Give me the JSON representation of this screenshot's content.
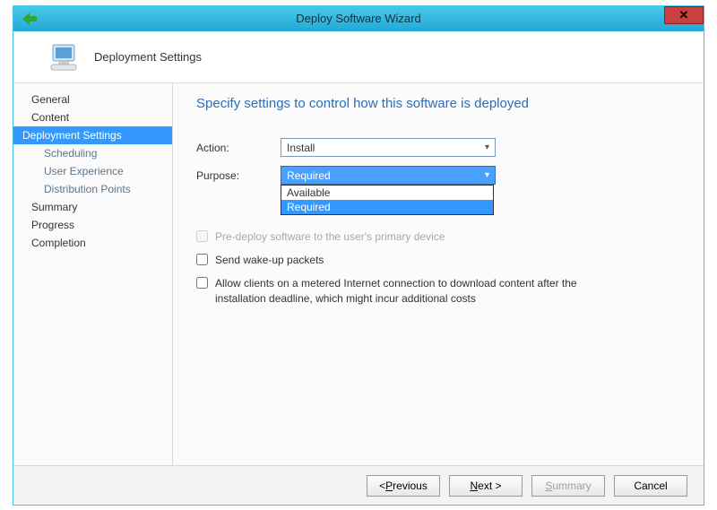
{
  "window": {
    "title": "Deploy Software Wizard"
  },
  "header": {
    "title": "Deployment Settings"
  },
  "sidebar": {
    "items": [
      {
        "label": "General",
        "sub": false,
        "selected": false
      },
      {
        "label": "Content",
        "sub": false,
        "selected": false
      },
      {
        "label": "Deployment Settings",
        "sub": false,
        "selected": true
      },
      {
        "label": "Scheduling",
        "sub": true,
        "selected": false
      },
      {
        "label": "User Experience",
        "sub": true,
        "selected": false
      },
      {
        "label": "Distribution Points",
        "sub": true,
        "selected": false
      },
      {
        "label": "Summary",
        "sub": false,
        "selected": false
      },
      {
        "label": "Progress",
        "sub": false,
        "selected": false
      },
      {
        "label": "Completion",
        "sub": false,
        "selected": false
      }
    ]
  },
  "content": {
    "heading": "Specify settings to control how this software is deployed",
    "action": {
      "label": "Action:",
      "value": "Install"
    },
    "purpose": {
      "label": "Purpose:",
      "value": "Required",
      "options": [
        "Available",
        "Required"
      ],
      "open": true,
      "highlighted": "Required"
    },
    "checks": {
      "predeploy": {
        "label": "Pre-deploy software to the user's primary device",
        "disabled": true,
        "checked": false
      },
      "wakeup": {
        "label": "Send wake-up packets",
        "disabled": false,
        "checked": false
      },
      "metered": {
        "label": "Allow clients on a metered Internet connection to download content after the installation deadline, which might incur additional costs",
        "disabled": false,
        "checked": false
      }
    }
  },
  "footer": {
    "previous_pre": "< ",
    "previous_u": "P",
    "previous_rest": "revious",
    "next_u": "N",
    "next_rest": "ext >",
    "summary_u": "S",
    "summary_rest": "ummary",
    "cancel": "Cancel"
  }
}
